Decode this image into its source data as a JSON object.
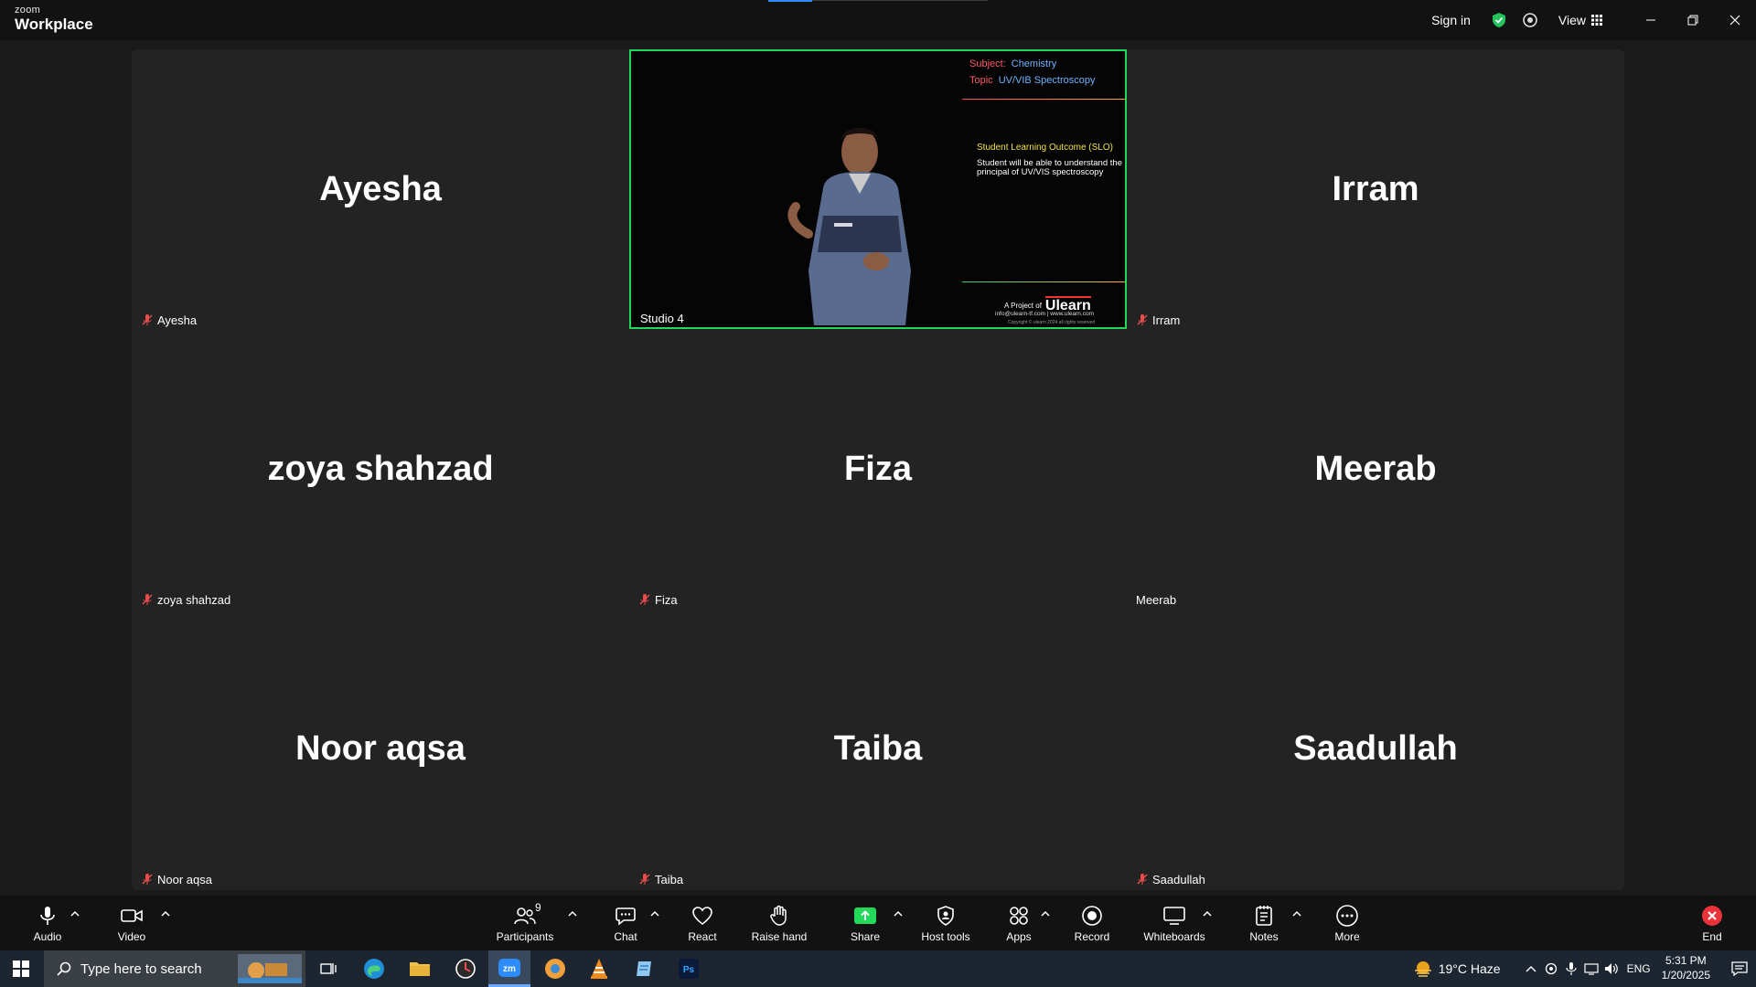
{
  "titlebar": {
    "brand_small": "zoom",
    "brand_big": "Workplace",
    "signin": "Sign in",
    "view": "View"
  },
  "tiles": [
    {
      "display_name": "Ayesha",
      "label": "Ayesha",
      "muted": true
    },
    {
      "display_name": "",
      "label": "Studio 4",
      "muted": false,
      "active": true
    },
    {
      "display_name": "Irram",
      "label": "Irram",
      "muted": true
    },
    {
      "display_name": "zoya shahzad",
      "label": "zoya shahzad",
      "muted": true
    },
    {
      "display_name": "Fiza",
      "label": "Fiza",
      "muted": true
    },
    {
      "display_name": "Meerab",
      "label": "Meerab",
      "muted": false
    },
    {
      "display_name": "Noor aqsa",
      "label": "Noor aqsa",
      "muted": true
    },
    {
      "display_name": "Taiba",
      "label": "Taiba",
      "muted": true
    },
    {
      "display_name": "Saadullah",
      "label": "Saadullah",
      "muted": true
    }
  ],
  "slide": {
    "subject_label": "Subject:",
    "subject_value": "Chemistry",
    "topic_label": "Topic",
    "topic_value": "UV/VIB Spectroscopy",
    "slo_title": "Student Learning Outcome (SLO)",
    "slo_text": "Student will be able to understand the principal of UV/VIS spectroscopy",
    "project_of": "A Project of",
    "brand": "Ulearn",
    "contact": "info@ulearn-tf.com | www.ulearn.com",
    "copyright": "Copyright © ulearn 2024 all rights reserved"
  },
  "toolbar": {
    "audio": "Audio",
    "video": "Video",
    "participants": "Participants",
    "participants_count": "9",
    "chat": "Chat",
    "react": "React",
    "raise_hand": "Raise hand",
    "share": "Share",
    "host_tools": "Host tools",
    "apps": "Apps",
    "record": "Record",
    "whiteboards": "Whiteboards",
    "notes": "Notes",
    "more": "More",
    "end": "End"
  },
  "taskbar": {
    "search_placeholder": "Type here to search",
    "weather": "19°C  Haze",
    "language": "ENG",
    "time": "5:31 PM",
    "date": "1/20/2025"
  },
  "colors": {
    "active_speaker": "#23d959",
    "mute_icon": "#e84c4c",
    "share_green": "#23d959",
    "end_red": "#e8333a"
  }
}
